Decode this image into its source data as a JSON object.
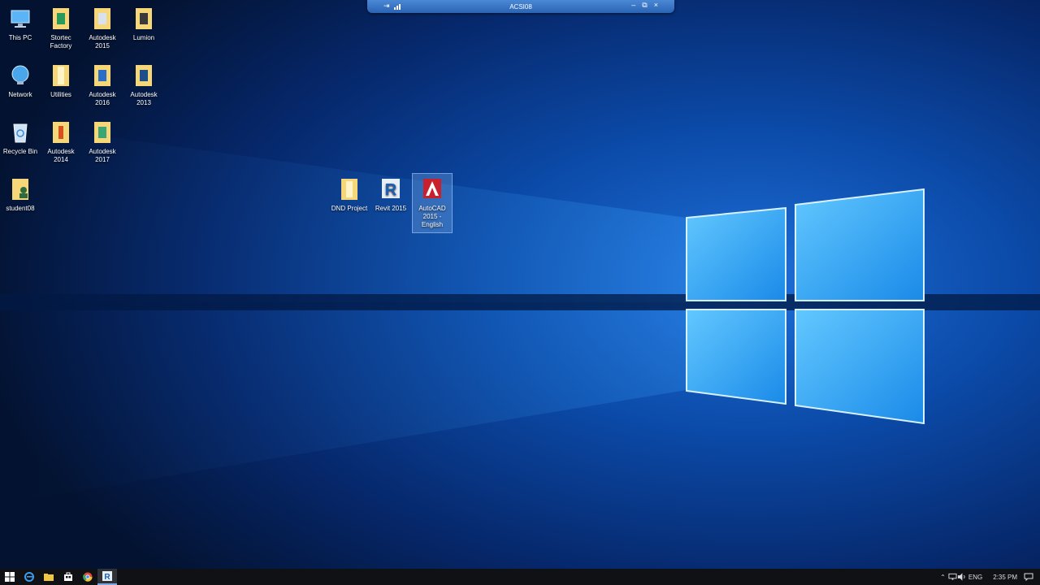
{
  "rdp_bar": {
    "title": "ACSI08",
    "pin": "⇥",
    "minimize": "–",
    "restore": "⧉",
    "close": "×"
  },
  "desktop_icons": [
    {
      "label": "This PC"
    },
    {
      "label": "Stortec Factory"
    },
    {
      "label": "Autodesk 2015"
    },
    {
      "label": "Lumion"
    },
    {
      "label": "Network"
    },
    {
      "label": "Utilities"
    },
    {
      "label": "Autodesk 2016"
    },
    {
      "label": "Autodesk 2013"
    },
    {
      "label": "Recycle Bin"
    },
    {
      "label": "Autodesk 2014"
    },
    {
      "label": "Autodesk 2017"
    },
    {
      "label": "student08"
    },
    {
      "label": "DND Project"
    },
    {
      "label": "Revit 2015"
    },
    {
      "label": "AutoCAD 2015 - English"
    }
  ],
  "taskbar": {
    "language": "ENG",
    "time": "2:35 PM",
    "apps": [
      "start-icon",
      "edge-icon",
      "file-explorer-icon",
      "store-icon",
      "chrome-icon",
      "revit-icon"
    ]
  },
  "colors": {
    "accent": "#2a64b4",
    "wallpaper_dark": "#03122e",
    "wallpaper_glow": "#4fb8ff"
  }
}
